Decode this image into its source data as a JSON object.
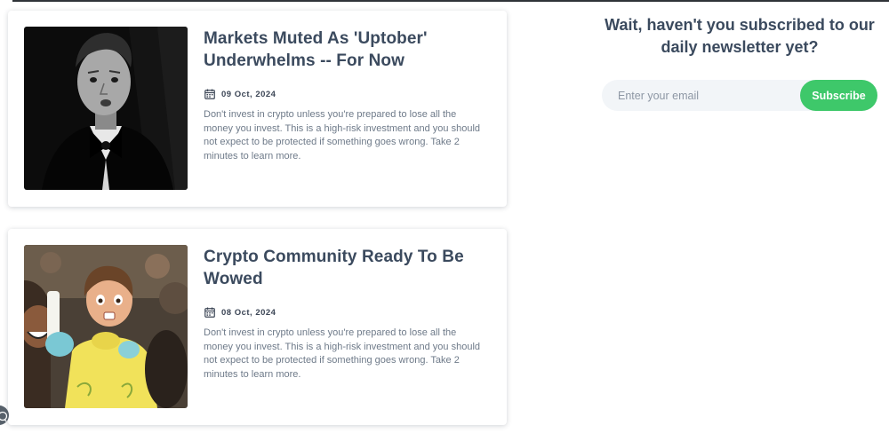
{
  "posts": [
    {
      "title": "Markets Muted As 'Uptober' Underwhelms -- For Now",
      "date": "09 Oct, 2024",
      "excerpt": "Don't invest in crypto unless you're prepared to lose all the money you invest. This is a high-risk investment and you should not expect to be protected if something goes wrong. Take 2 minutes to learn more.",
      "thumbnail_icon": "man-in-tuxedo-photo"
    },
    {
      "title": "Crypto Community Ready To Be Wowed",
      "date": "08 Oct, 2024",
      "excerpt": "Don't invest in crypto unless you're prepared to lose all the money you invest. This is a high-risk investment and you should not expect to be protected if something goes wrong. Take 2 minutes to learn more.",
      "thumbnail_icon": "surprised-girl-photo"
    }
  ],
  "newsletter": {
    "heading": "Wait, haven't you subscribed  to our daily newsletter yet?",
    "email_placeholder": "Enter your email",
    "subscribe_label": "Subscribe"
  },
  "colors": {
    "accent": "#3ec86a",
    "heading": "#3b4a5e",
    "body_text": "#6e7a89",
    "input_bg": "#f2f5f8"
  }
}
